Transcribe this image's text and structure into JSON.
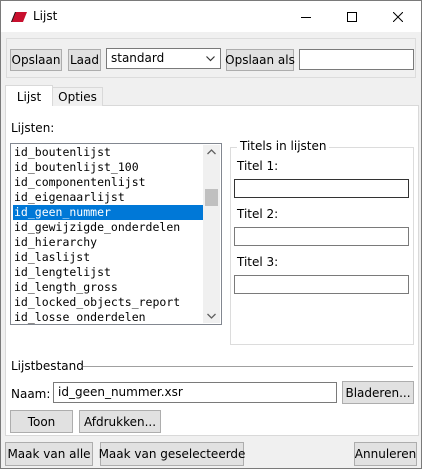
{
  "window": {
    "title": "Lijst"
  },
  "toolbar": {
    "save_label": "Opslaan",
    "load_label": "Laad",
    "preset_value": "standard",
    "save_as_label": "Opslaan als",
    "save_as_value": ""
  },
  "tabs": [
    {
      "label": "Lijst"
    },
    {
      "label": "Opties"
    }
  ],
  "lists": {
    "label": "Lijsten:",
    "items": [
      "id_boutenlijst",
      "id_boutenlijst_100",
      "id_componentenlijst",
      "id_eigenaarlijst",
      "id_geen_nummer",
      "id_gewijzigde_onderdelen",
      "id_hierarchy",
      "id_laslijst",
      "id_lengtelijst",
      "id_length_gross",
      "id_locked_objects_report",
      "id_losse onderdelen"
    ],
    "selected_index": 4
  },
  "titles": {
    "group_label": "Titels in lijsten",
    "title1_label": "Titel 1:",
    "title1_value": "",
    "title2_label": "Titel 2:",
    "title2_value": "",
    "title3_label": "Titel 3:",
    "title3_value": ""
  },
  "file": {
    "section_label": "Lijstbestand",
    "name_label": "Naam:",
    "name_value": "id_geen_nummer.xsr",
    "browse_label": "Bladeren...",
    "show_label": "Toon",
    "print_label": "Afdrukken..."
  },
  "footer": {
    "make_all_label": "Maak van alle",
    "make_selected_label": "Maak van geselecteerde",
    "cancel_label": "Annuleren"
  }
}
